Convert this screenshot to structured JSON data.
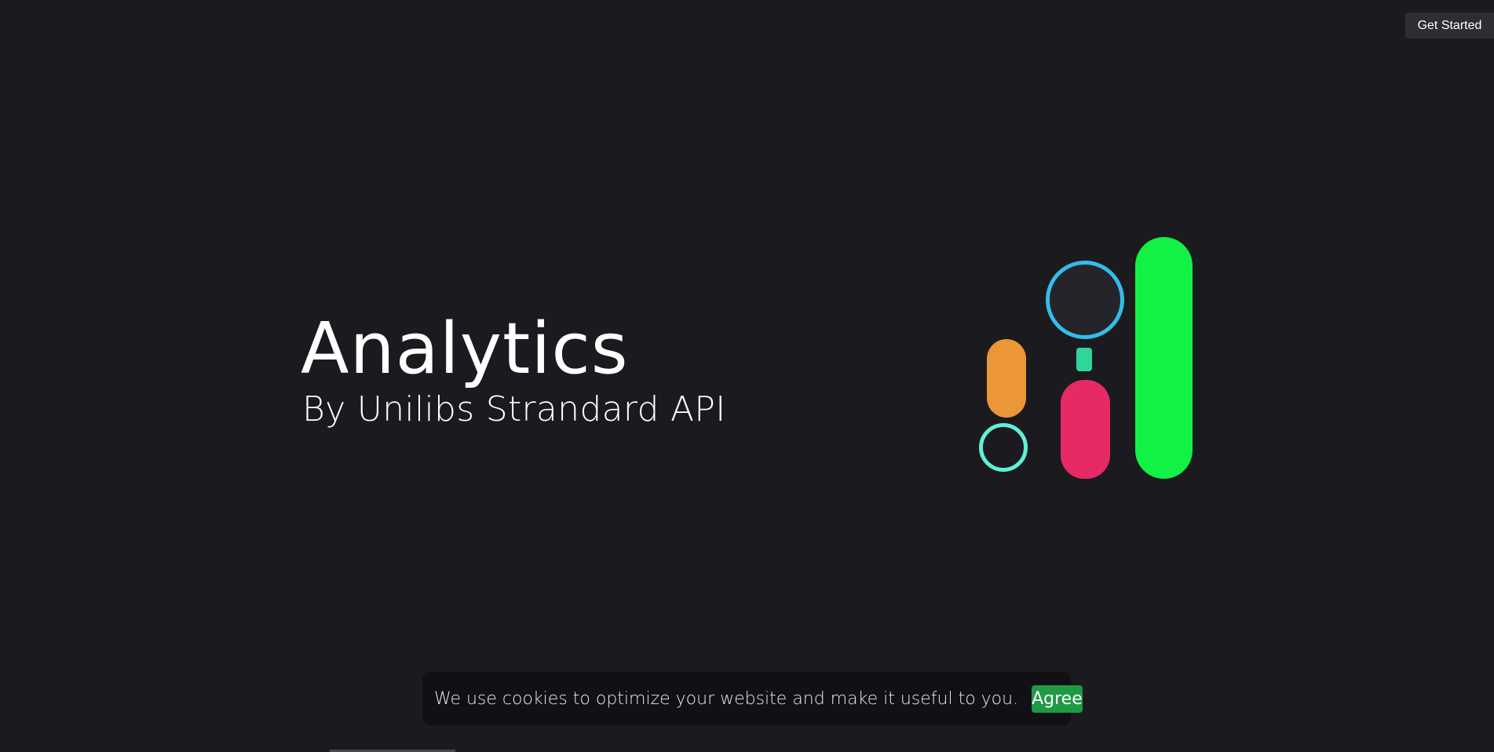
{
  "header": {
    "get_started_label": "Get Started"
  },
  "hero": {
    "title": "Analytics",
    "subtitle": "By Unilibs Strandard API"
  },
  "illustration": {
    "colors": {
      "teal_ring": "#5ff0d6",
      "orange_pill": "#eb9638",
      "blue_ring": "#33bde7",
      "green_tab": "#30d59a",
      "pink_pill": "#e62a66",
      "lime_pill": "#11f244"
    }
  },
  "cookie_banner": {
    "message": "We use cookies to optimize your website and make it useful to you.",
    "agree_label": "Agree"
  },
  "theme": {
    "background": "#1b1a1f",
    "accent": "#1f9a44"
  }
}
